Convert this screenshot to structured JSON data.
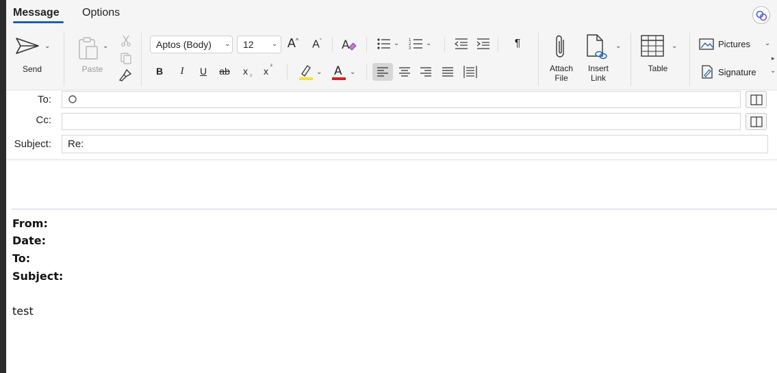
{
  "tabs": [
    {
      "label": "Message",
      "active": true
    },
    {
      "label": "Options",
      "active": false
    }
  ],
  "ribbon": {
    "send_label": "Send",
    "paste_label": "Paste",
    "font_name": "Aptos (Body)",
    "font_size": "12",
    "format": {
      "bold": "B",
      "italic": "I",
      "underline": "U",
      "strike": "ab",
      "subscript": "x",
      "superscript": "x",
      "pilcrow": "¶"
    },
    "attach_label_1": "Attach",
    "attach_label_2": "File",
    "link_label_1": "Insert",
    "link_label_2": "Link",
    "table_label": "Table",
    "pictures_label": "Pictures",
    "signature_label": "Signature",
    "highlight_color": "#f5e042",
    "font_color": "#d22020"
  },
  "header": {
    "to_label": "To:",
    "cc_label": "Cc:",
    "subject_label": "Subject:",
    "to_value": "",
    "cc_value": "",
    "subject_value": "Re:"
  },
  "body": {
    "from_label": "From:",
    "date_label": "Date:",
    "to_label": "To:",
    "subject_label": "Subject:",
    "text": "test"
  },
  "colors": {
    "accent": "#1a5fb4",
    "ribbon_bg": "#f5f5f5"
  }
}
